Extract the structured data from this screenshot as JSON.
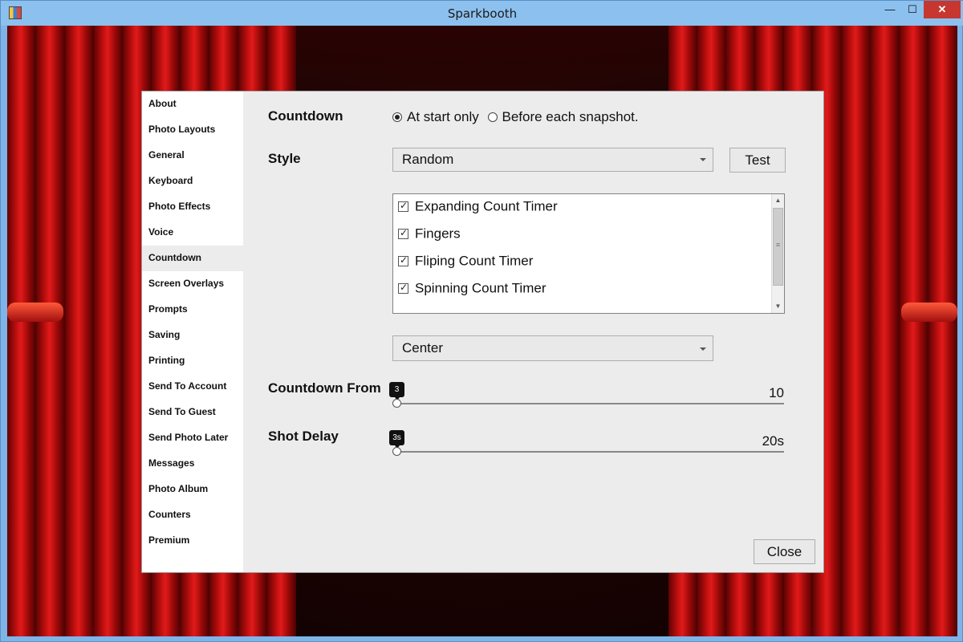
{
  "window": {
    "title": "Sparkbooth",
    "minimize_glyph": "—",
    "maximize_glyph": "☐",
    "close_glyph": "✕"
  },
  "sidebar": {
    "items": [
      {
        "label": "About"
      },
      {
        "label": "Photo Layouts"
      },
      {
        "label": "General"
      },
      {
        "label": "Keyboard"
      },
      {
        "label": "Photo Effects"
      },
      {
        "label": "Voice"
      },
      {
        "label": "Countdown",
        "active": true
      },
      {
        "label": "Screen Overlays"
      },
      {
        "label": "Prompts"
      },
      {
        "label": "Saving"
      },
      {
        "label": "Printing"
      },
      {
        "label": "Send To Account"
      },
      {
        "label": "Send To Guest"
      },
      {
        "label": "Send Photo Later"
      },
      {
        "label": "Messages"
      },
      {
        "label": "Photo Album"
      },
      {
        "label": "Counters"
      },
      {
        "label": "Premium"
      }
    ]
  },
  "countdown": {
    "label": "Countdown",
    "options": [
      {
        "label": "At start only",
        "selected": true
      },
      {
        "label": "Before each snapshot.",
        "selected": false
      }
    ]
  },
  "style": {
    "label": "Style",
    "selected": "Random",
    "test_label": "Test",
    "list": [
      {
        "label": "Expanding Count Timer",
        "checked": true
      },
      {
        "label": "Fingers",
        "checked": true
      },
      {
        "label": "Fliping Count Timer",
        "checked": true
      },
      {
        "label": "Spinning Count Timer",
        "checked": true
      }
    ],
    "scroll_up_glyph": "▲",
    "scroll_down_glyph": "▼",
    "scroll_grip_glyph": "≡"
  },
  "position": {
    "selected": "Center"
  },
  "countdown_from": {
    "label": "Countdown From",
    "value_label": "3",
    "max_label": "10",
    "fraction": 0
  },
  "shot_delay": {
    "label": "Shot Delay",
    "value_label": "3s",
    "max_label": "20s",
    "fraction": 0
  },
  "close_label": "Close",
  "colors": {
    "curtain_red": "#c41010",
    "panel_bg": "#ececec",
    "title_bar": "#8cc0ee"
  }
}
